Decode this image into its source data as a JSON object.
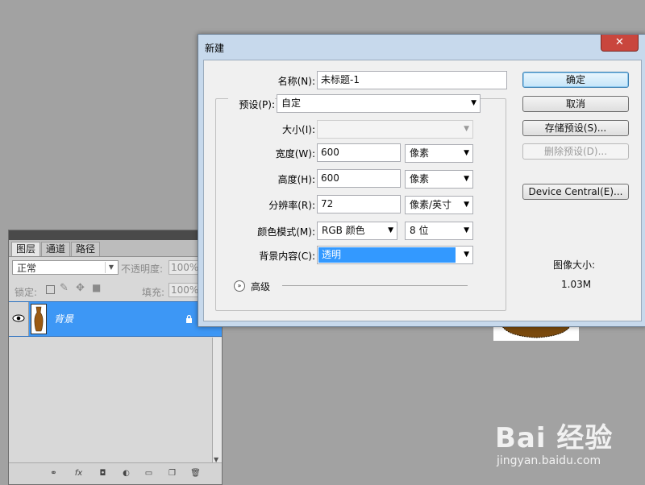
{
  "layers_panel": {
    "tabs": [
      "图层",
      "通道",
      "路径"
    ],
    "blend_mode": "正常",
    "opacity_label": "不透明度:",
    "opacity_value": "100%",
    "lock_label": "锁定:",
    "fill_label": "填充:",
    "fill_value": "100%",
    "layers": [
      {
        "name": "背景"
      }
    ],
    "bottom_icons": [
      "link-icon",
      "fx-icon",
      "mask-icon",
      "adjustment-icon",
      "folder-icon",
      "new-layer-icon",
      "trash-icon"
    ]
  },
  "watermark": {
    "logo": "Bai 经验",
    "url": "jingyan.baidu.com"
  },
  "dialog": {
    "title": "新建",
    "close_label": "✕",
    "name_label": "名称(N):",
    "name_value": "未标题-1",
    "preset_label": "预设(P):",
    "preset_value": "自定",
    "size_label": "大小(I):",
    "size_value": "",
    "width_label": "宽度(W):",
    "width_value": "600",
    "width_unit": "像素",
    "height_label": "高度(H):",
    "height_value": "600",
    "height_unit": "像素",
    "resolution_label": "分辨率(R):",
    "resolution_value": "72",
    "resolution_unit": "像素/英寸",
    "color_mode_label": "颜色模式(M):",
    "color_mode_value": "RGB 颜色",
    "bit_depth": "8 位",
    "background_label": "背景内容(C):",
    "background_value": "透明",
    "advanced_label": "高级",
    "buttons": {
      "ok": "确定",
      "cancel": "取消",
      "save_preset": "存储预设(S)...",
      "delete_preset": "删除预设(D)...",
      "device_central": "Device Central(E)..."
    },
    "image_size_label": "图像大小:",
    "image_size_value": "1.03M"
  }
}
